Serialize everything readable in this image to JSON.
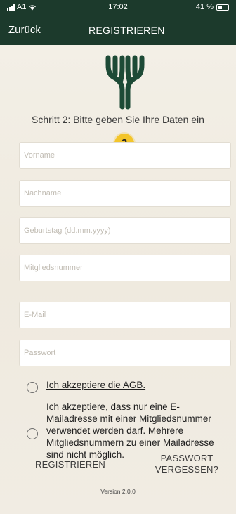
{
  "status_bar": {
    "carrier": "A1",
    "time": "17:02",
    "battery": "41 %",
    "battery_level": 0.41
  },
  "nav": {
    "back_label": "Zurück",
    "title": "REGISTRIEREN"
  },
  "colors": {
    "header_bg": "#1c3a2c",
    "logo": "#1d4a36",
    "badge": "#f3c52a",
    "background": "#f1ede4"
  },
  "step": {
    "text": "Schritt 2: Bitte geben Sie Ihre Daten ein",
    "badge": "2"
  },
  "form": {
    "first_name_placeholder": "Vorname",
    "last_name_placeholder": "Nachname",
    "birthday_placeholder": "Geburtstag (dd.mm.yyyy)",
    "member_number_placeholder": "Mitgliedsnummer",
    "email_placeholder": "E-Mail",
    "password_placeholder": "Passwort"
  },
  "consents": {
    "agb": "Ich akzeptiere die AGB.",
    "mail_rule": "Ich akzeptiere, dass nur eine E-Mailadresse mit einer Mitgliedsnummer verwendet werden darf. Mehrere Mitgliedsnummern zu einer Mailadresse sind nicht möglich."
  },
  "actions": {
    "register": "REGISTRIEREN",
    "forgot_password": "PASSWORT VERGESSEN?"
  },
  "version": "Version 2.0.0",
  "icons": [
    "signal-icon",
    "wifi-icon",
    "battery-icon",
    "antler-logo-icon"
  ]
}
